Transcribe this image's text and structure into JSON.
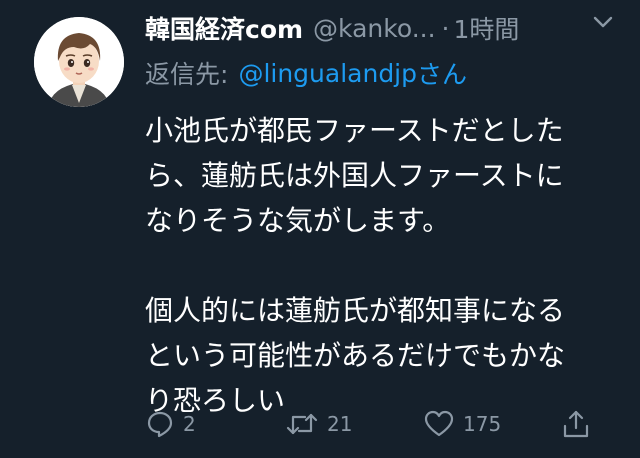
{
  "tweet": {
    "display_name": "韓国経済com",
    "handle": "@kanko...",
    "separator": "·",
    "time": "1時間",
    "reply_label": "返信先:",
    "reply_handle": "@lingualandjp",
    "reply_suffix": "さん",
    "body_lines": [
      "小池氏が都民ファーストだとした",
      "ら、蓮舫氏は外国人ファーストに",
      "なりそうな気がします。",
      "",
      "個人的には蓮舫氏が都知事になる",
      "という可能性があるだけでもかな",
      "り恐ろしい"
    ],
    "counts": {
      "replies": "2",
      "retweets": "21",
      "likes": "175"
    }
  },
  "icons": {
    "avatar": "avatar-illustration",
    "caret": "chevron-down-icon",
    "reply": "reply-icon",
    "retweet": "retweet-icon",
    "like": "heart-icon",
    "share": "share-icon"
  },
  "colors": {
    "background": "#15202b",
    "text": "#ffffff",
    "secondary": "#8b98a5",
    "link": "#1d9bf0"
  }
}
